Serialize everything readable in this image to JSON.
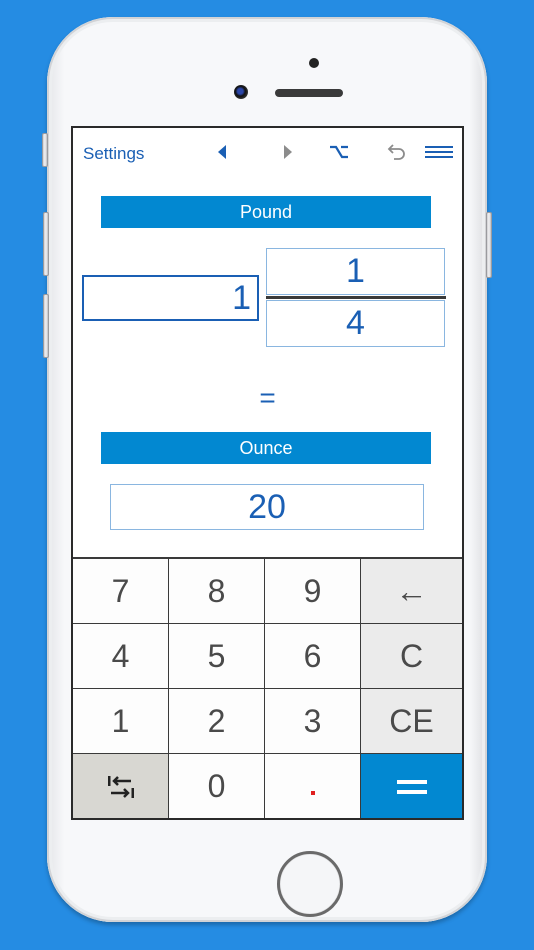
{
  "toolbar": {
    "settings_label": "Settings",
    "icons": [
      "back-arrow-icon",
      "forward-arrow-icon",
      "option-icon",
      "undo-icon",
      "menu-icon"
    ]
  },
  "converter": {
    "from_unit": "Pound",
    "to_unit": "Ounce",
    "whole": "1",
    "numerator": "1",
    "denominator": "4",
    "equals": "=",
    "result": "20"
  },
  "keypad": {
    "rows": [
      [
        "7",
        "8",
        "9",
        "←"
      ],
      [
        "4",
        "5",
        "6",
        "C"
      ],
      [
        "1",
        "2",
        "3",
        "CE"
      ],
      [
        "swap",
        "0",
        ".",
        "="
      ]
    ]
  },
  "colors": {
    "accent": "#0288d1",
    "text_blue": "#1a5fb4",
    "background": "#258ce3",
    "decimal_dot": "#e02020"
  }
}
